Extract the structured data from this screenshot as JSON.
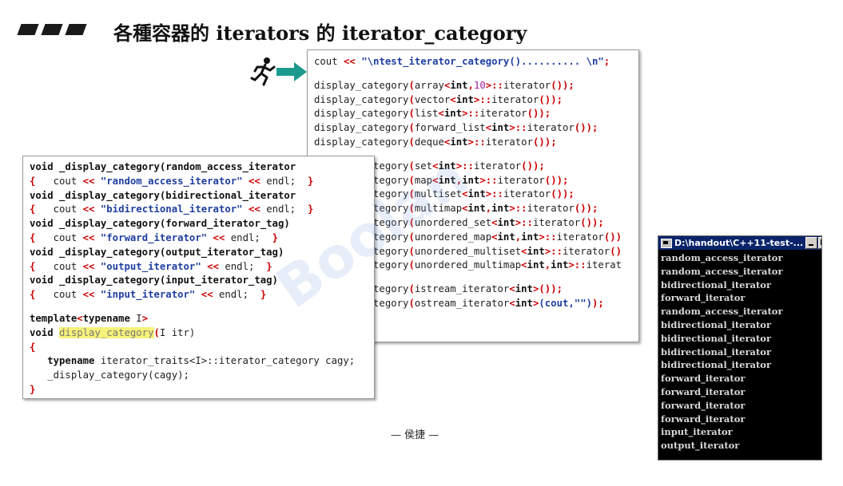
{
  "title": "各種容器的 iterators 的 iterator_category",
  "footer": "— 侯捷 —",
  "main_code": {
    "line1": [
      "cout ",
      "<<",
      " ",
      "\"\\ntest_iterator_category().......... \\n\"",
      ";"
    ],
    "group1": [
      [
        "display_category",
        "(",
        "array",
        "<",
        "int",
        ",",
        "10",
        ">",
        "::",
        "iterator",
        "()",
        ");"
      ],
      [
        "display_category",
        "(",
        "vector",
        "<",
        "int",
        "",
        "",
        ">",
        "::",
        "iterator",
        "()",
        ");"
      ],
      [
        "display_category",
        "(",
        "list",
        "<",
        "int",
        "",
        "",
        ">",
        "::",
        "iterator",
        "()",
        ");"
      ],
      [
        "display_category",
        "(",
        "forward_list",
        "<",
        "int",
        "",
        "",
        ">",
        "::",
        "iterator",
        "()",
        ");"
      ],
      [
        "display_category",
        "(",
        "deque",
        "<",
        "int",
        "",
        "",
        ">",
        "::",
        "iterator",
        "()",
        ");"
      ]
    ],
    "group2": [
      [
        "display_category",
        "(",
        "set",
        "<",
        "int",
        "",
        "",
        ">",
        "::",
        "iterator",
        "()",
        ");"
      ],
      [
        "display_category",
        "(",
        "map",
        "<",
        "int",
        ",",
        "int",
        ">",
        "::",
        "iterator",
        "()",
        ");"
      ],
      [
        "display_category",
        "(",
        "multiset",
        "<",
        "int",
        "",
        "",
        ">",
        "::",
        "iterator",
        "()",
        ");"
      ],
      [
        "display_category",
        "(",
        "multimap",
        "<",
        "int",
        ",",
        "int",
        ">",
        "::",
        "iterator",
        "()",
        ");"
      ],
      [
        "display_category",
        "(",
        "unordered_set",
        "<",
        "int",
        "",
        "",
        ">",
        "::",
        "iterator",
        "()",
        ");"
      ],
      [
        "display_category",
        "(",
        "unordered_map",
        "<",
        "int",
        ",",
        "int",
        ">",
        "::",
        "iterator",
        "()",
        ")"
      ],
      [
        "display_category",
        "(",
        "unordered_multiset",
        "<",
        "int",
        "",
        "",
        ">",
        "::",
        "iterator",
        "()",
        ""
      ],
      [
        "display_category",
        "(",
        "unordered_multimap",
        "<",
        "int",
        ",",
        "int",
        ">",
        "::",
        "iterat",
        "",
        ""
      ]
    ],
    "group3": [
      [
        "display_category",
        "(",
        "istream_iterator",
        "<",
        "int",
        "",
        "",
        ">",
        "",
        "",
        "()",
        ");"
      ],
      [
        "display_category",
        "(",
        "ostream_iterator",
        "<",
        "int",
        "",
        "",
        ">",
        "",
        "",
        "(cout,\"\")",
        ");"
      ]
    ]
  },
  "left_code": {
    "funcs": [
      {
        "sig": "void _display_category(random_access_iterator",
        "msg": "\"random_access_iterator\""
      },
      {
        "sig": "void _display_category(bidirectional_iterator",
        "msg": "\"bidirectional_iterator\""
      },
      {
        "sig": "void _display_category(forward_iterator_tag)",
        "msg": "\"forward_iterator\""
      },
      {
        "sig": "void _display_category(output_iterator_tag)",
        "msg": "\"output_iterator\""
      },
      {
        "sig": "void _display_category(input_iterator_tag)",
        "msg": "\"input_iterator\""
      }
    ],
    "cout_kw": "cout",
    "op": "<<",
    "endl": "endl;",
    "template_kw": "template",
    "typename_kw": "typename",
    "template_arg": "I",
    "void_kw": "void",
    "display_name": "display_category",
    "param": "I itr)",
    "traits_line": "iterator_traits<I>::iterator_category cagy;",
    "call_line": "_display_category(cagy);"
  },
  "console": {
    "title": "D:\\handout\\C++11-test-...",
    "lines": [
      "random_access_iterator",
      "random_access_iterator",
      "bidirectional_iterator",
      "forward_iterator",
      "random_access_iterator",
      "bidirectional_iterator",
      "bidirectional_iterator",
      "bidirectional_iterator",
      "bidirectional_iterator",
      "forward_iterator",
      "forward_iterator",
      "forward_iterator",
      "forward_iterator",
      "input_iterator",
      "output_iterator"
    ]
  },
  "watermark": "Boolan",
  "colors": {
    "string": "#1f3fa0",
    "operator": "#c00000",
    "highlight": "#f7f27a",
    "console_bg": "#000000",
    "console_title": "#0a246a"
  }
}
